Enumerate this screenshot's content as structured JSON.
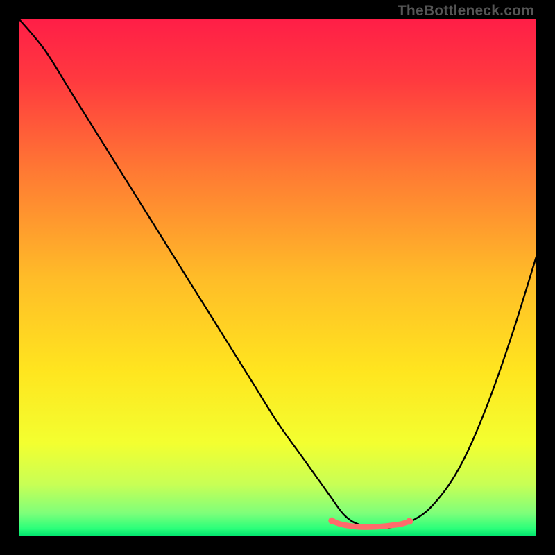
{
  "watermark": "TheBottleneck.com",
  "chart_data": {
    "type": "line",
    "title": "",
    "xlabel": "",
    "ylabel": "",
    "xlim": [
      0,
      100
    ],
    "ylim": [
      0,
      100
    ],
    "gradient_stops": [
      {
        "offset": 0.0,
        "color": "#ff1e47"
      },
      {
        "offset": 0.12,
        "color": "#ff3a3f"
      },
      {
        "offset": 0.3,
        "color": "#ff7b33"
      },
      {
        "offset": 0.5,
        "color": "#ffbc28"
      },
      {
        "offset": 0.68,
        "color": "#ffe51f"
      },
      {
        "offset": 0.82,
        "color": "#f3ff30"
      },
      {
        "offset": 0.9,
        "color": "#c8ff55"
      },
      {
        "offset": 0.955,
        "color": "#7fff7a"
      },
      {
        "offset": 0.985,
        "color": "#2bff7a"
      },
      {
        "offset": 1.0,
        "color": "#00e36e"
      }
    ],
    "series": [
      {
        "name": "bottleneck-curve",
        "color": "#000000",
        "x": [
          0,
          5,
          10,
          15,
          20,
          25,
          30,
          35,
          40,
          45,
          50,
          55,
          60,
          63,
          66,
          70,
          73,
          76,
          80,
          85,
          90,
          95,
          100
        ],
        "y": [
          100,
          94,
          86,
          78,
          70,
          62,
          54,
          46,
          38,
          30,
          22,
          15,
          8,
          4,
          2.2,
          1.5,
          2.0,
          3.0,
          6,
          13,
          24,
          38,
          54
        ]
      },
      {
        "name": "valley-highlight",
        "color": "#ff6b6b",
        "x": [
          60.5,
          62,
          64,
          66,
          68,
          70,
          72,
          74,
          75.5
        ],
        "y": [
          3.0,
          2.4,
          2.0,
          1.8,
          1.8,
          1.9,
          2.1,
          2.4,
          2.9
        ]
      }
    ],
    "highlight_endpoints": [
      {
        "x": 60.5,
        "y": 3.0
      },
      {
        "x": 75.5,
        "y": 2.9
      }
    ]
  }
}
